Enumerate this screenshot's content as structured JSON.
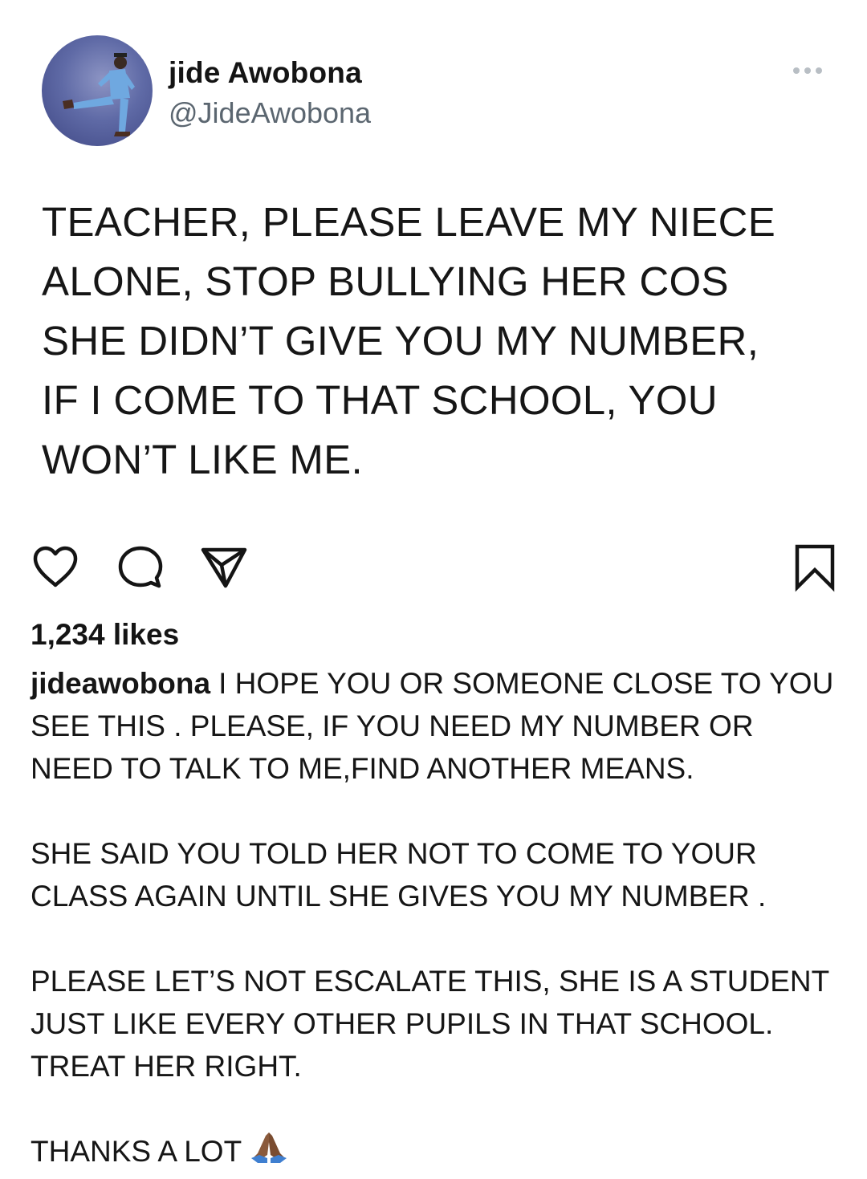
{
  "author": {
    "display_name": "jide Awobona",
    "handle": "@JideAwobona"
  },
  "tweet": {
    "text": "TEACHER, PLEASE LEAVE MY NIECE\nALONE, STOP BULLYING HER COS\nSHE DIDN’T GIVE YOU MY NUMBER,\nIF I COME TO THAT SCHOOL, YOU\nWON’T LIKE ME."
  },
  "post": {
    "likes": "1,234 likes",
    "caption_user": "jideawobona",
    "caption_paragraphs": [
      "I HOPE YOU OR SOMEONE CLOSE TO YOU\nSEE THIS . PLEASE, IF YOU NEED MY NUMBER OR\nNEED TO TALK TO ME,FIND ANOTHER MEANS.",
      "SHE SAID YOU TOLD HER NOT TO COME TO YOUR\nCLASS AGAIN UNTIL SHE GIVES YOU MY NUMBER .",
      "PLEASE LET’S NOT ESCALATE THIS, SHE IS A STUDENT\nJUST LIKE EVERY OTHER PUPILS IN THAT SCHOOL.\nTREAT HER RIGHT.",
      "THANKS A LOT"
    ]
  },
  "icons": {
    "more": "more-icon",
    "like": "heart-icon",
    "comment": "comment-icon",
    "share": "paper-plane-icon",
    "bookmark": "bookmark-icon",
    "emoji": "praying-hands-icon"
  },
  "colors": {
    "text": "#161616",
    "handle": "#5b6670",
    "icon": "#141414",
    "more_dots": "#b8bec4",
    "emoji_skin": "#8a5a3c",
    "emoji_sleeve": "#3f7fd0"
  }
}
